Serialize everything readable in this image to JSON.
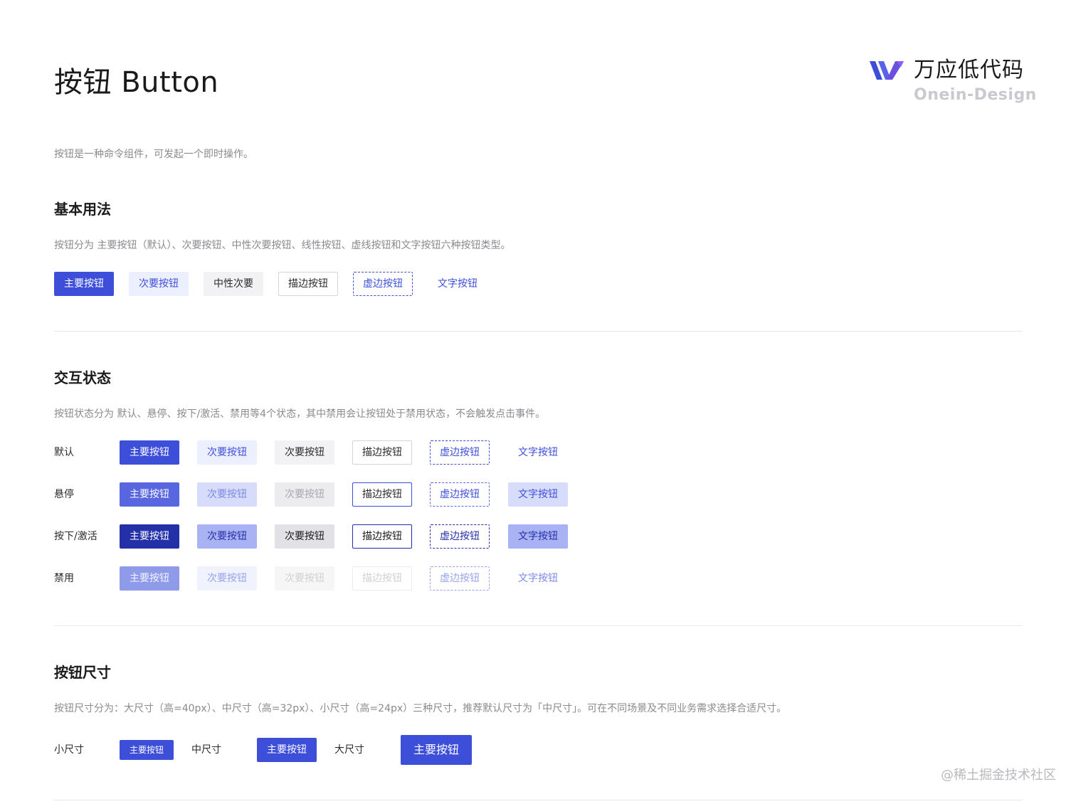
{
  "header": {
    "title": "按钮 Button",
    "logo_cn": "万应低代码",
    "logo_en": "Onein-Design"
  },
  "intro": "按钮是一种命令组件，可发起一个即时操作。",
  "basic": {
    "title": "基本用法",
    "desc": "按钮分为 主要按钮（默认）、次要按钮、中性次要按钮、线性按钮、虚线按钮和文字按钮六种按钮类型。",
    "buttons": [
      "主要按钮",
      "次要按钮",
      "中性次要",
      "描边按钮",
      "虚边按钮",
      "文字按钮"
    ]
  },
  "states": {
    "title": "交互状态",
    "desc": "按钮状态分为 默认、悬停、按下/激活、禁用等4个状态，其中禁用会让按钮处于禁用状态，不会触发点击事件。",
    "rows": [
      {
        "label": "默认",
        "buttons": [
          "主要按钮",
          "次要按钮",
          "次要按钮",
          "描边按钮",
          "虚边按钮",
          "文字按钮"
        ]
      },
      {
        "label": "悬停",
        "buttons": [
          "主要按钮",
          "次要按钮",
          "次要按钮",
          "描边按钮",
          "虚边按钮",
          "文字按钮"
        ]
      },
      {
        "label": "按下/激活",
        "buttons": [
          "主要按钮",
          "次要按钮",
          "次要按钮",
          "描边按钮",
          "虚边按钮",
          "文字按钮"
        ]
      },
      {
        "label": "禁用",
        "buttons": [
          "主要按钮",
          "次要按钮",
          "次要按钮",
          "描边按钮",
          "虚边按钮",
          "文字按钮"
        ]
      }
    ]
  },
  "sizes": {
    "title": "按钮尺寸",
    "desc": "按钮尺寸分为：大尺寸（高=40px）、中尺寸（高=32px）、小尺寸（高=24px）三种尺寸，推荐默认尺寸为「中尺寸」。可在不同场景及不同业务需求选择合适尺寸。",
    "small_label": "小尺寸",
    "small_button": "主要按钮",
    "medium_label": "中尺寸",
    "medium_button": "主要按钮",
    "large_label": "大尺寸",
    "large_button": "主要按钮"
  },
  "watermark": "@稀土掘金技术社区",
  "colors": {
    "primary": "#3d4ed8",
    "primary_hover": "#5867e0",
    "primary_active": "#2330a8",
    "primary_disabled": "#8f9be8"
  },
  "icons": {
    "logo_mark": "onein-logo-icon"
  }
}
